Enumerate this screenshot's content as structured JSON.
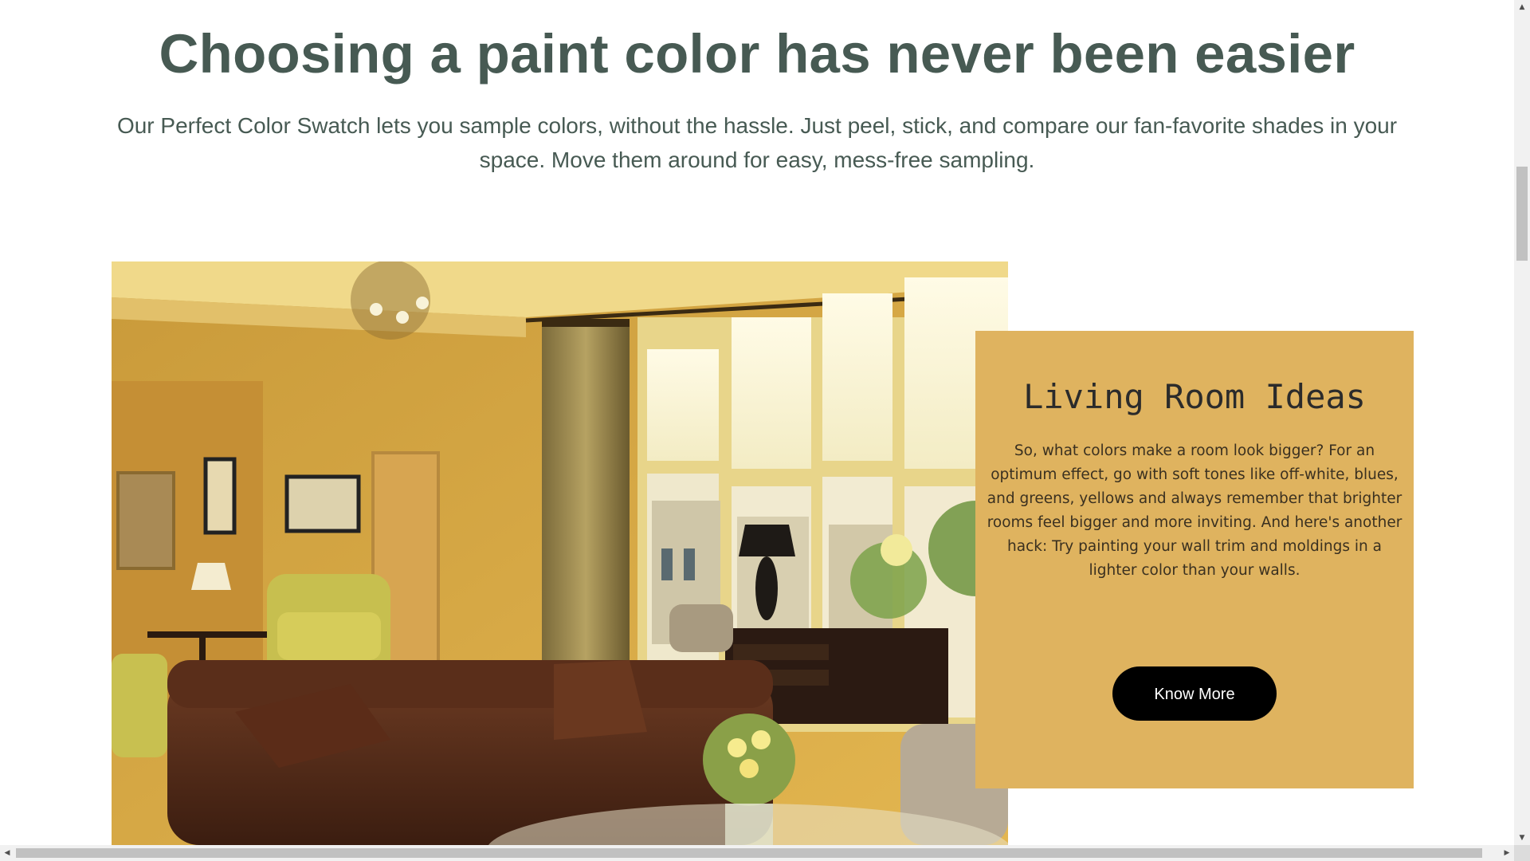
{
  "hero": {
    "headline": "Choosing a paint color has never been easier",
    "subtext": "Our Perfect Color Swatch lets you sample colors, without the hassle. Just peel, stick, and compare our fan-favorite shades in your space. Move them around for easy, mess-free sampling."
  },
  "card": {
    "title": "Living Room Ideas",
    "body": "So, what colors make a room look bigger? For an optimum effect, go with soft tones like off-white, blues, and greens, yellows and always remember that brighter rooms feel bigger and more inviting. And here's another hack: Try painting your wall trim and moldings in a lighter color than your walls.",
    "button_label": "Know More",
    "background_color": "#dfb35f"
  },
  "scrollbars": {
    "up_icon": "triangle-up-icon",
    "down_icon": "triangle-down-icon",
    "left_icon": "triangle-left-icon",
    "right_icon": "triangle-right-icon"
  },
  "colors": {
    "heading_text": "#475a53",
    "button_bg": "#000000",
    "button_text": "#ffffff"
  }
}
